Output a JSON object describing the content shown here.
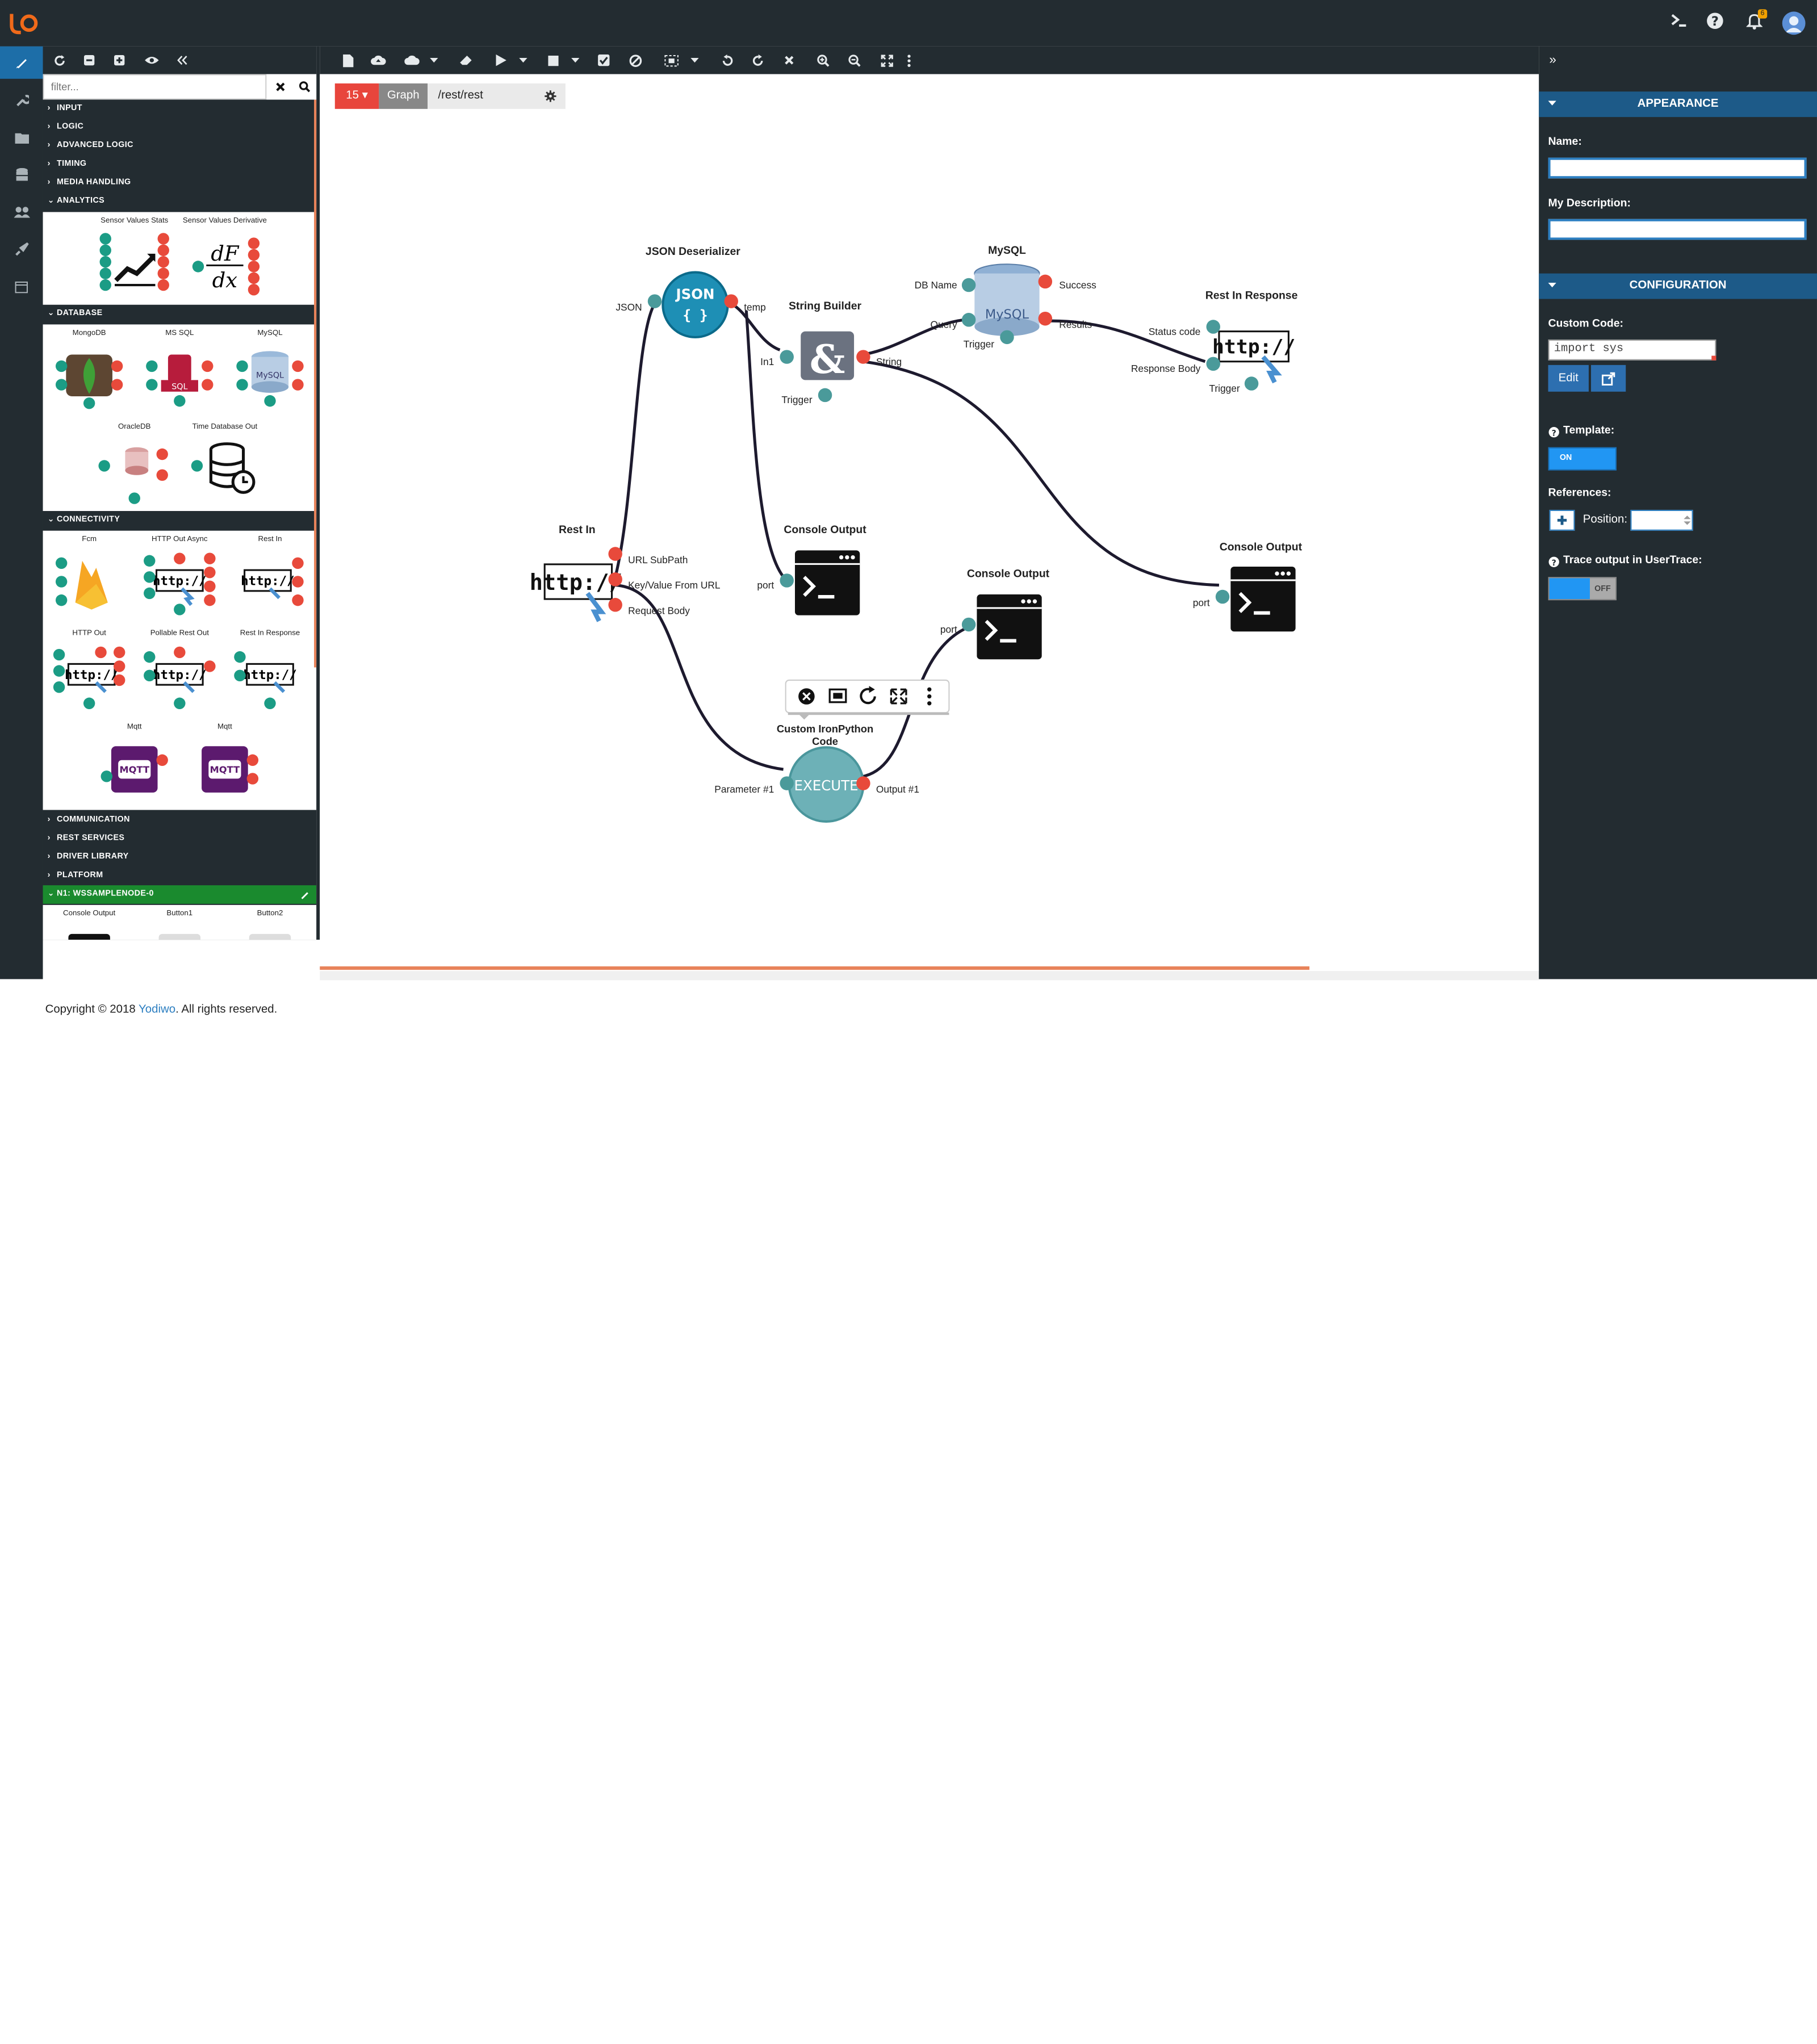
{
  "topbar": {
    "notifications_count": "6",
    "icons": [
      "logo",
      "terminal-icon",
      "help-icon",
      "bell-icon",
      "user-icon"
    ]
  },
  "left_toolbar": {
    "icons": [
      "refresh-icon",
      "collapse-all-icon",
      "expand-all-icon",
      "visibility-icon",
      "double-chevron-left-icon"
    ]
  },
  "main_toolbar": {
    "icons": [
      "new-file-icon",
      "upload-cloud-icon",
      "deploy-icon",
      "dropdown-icon",
      "eraser-icon",
      "play-icon",
      "dropdown-icon",
      "stop-icon",
      "dropdown-icon",
      "check-icon",
      "ban-icon",
      "select-icon",
      "dropdown-icon",
      "undo-icon",
      "redo-icon",
      "close-icon",
      "zoom-in-icon",
      "zoom-out-icon",
      "fit-icon",
      "more-icon"
    ]
  },
  "filter": {
    "placeholder": "filter..."
  },
  "categories": {
    "input": "INPUT",
    "logic": "LOGIC",
    "advanced_logic": "ADVANCED LOGIC",
    "timing": "TIMING",
    "media": "MEDIA HANDLING",
    "analytics": "ANALYTICS",
    "database": "DATABASE",
    "connectivity": "CONNECTIVITY",
    "communication": "COMMUNICATION",
    "rest": "REST SERVICES",
    "driver": "DRIVER LIBRARY",
    "platform": "PLATFORM",
    "node": "N1: WSSAMPLENODE-0"
  },
  "palette": {
    "analytics": [
      "Sensor Values Stats",
      "Sensor Values Derivative"
    ],
    "database": [
      "MongoDB",
      "MS SQL",
      "MySQL",
      "OracleDB",
      "Time Database Out"
    ],
    "connectivity": [
      "Fcm",
      "HTTP Out Async",
      "Rest In",
      "HTTP Out",
      "Pollable Rest Out",
      "Rest In Response",
      "Mqtt",
      "Mqtt"
    ],
    "node": [
      "Console Output",
      "Button1",
      "Button2"
    ]
  },
  "palette_icon_text": {
    "sql": "SQL",
    "mysql": "MySQL",
    "http": "http://",
    "mqtt": "MQTT",
    "json": "JSON",
    "json_braces": "{ }",
    "execute": "EXECUTE",
    "dfdx_num": "dF",
    "dfdx_den": "dx"
  },
  "graph_header": {
    "number": "15",
    "tab": "Graph",
    "path": "/rest/rest"
  },
  "nodes": {
    "json_deserializer": {
      "title": "JSON Deserializer",
      "in": "JSON",
      "out": "temp"
    },
    "string_builder": {
      "title": "String Builder",
      "in": "In1",
      "trigger": "Trigger",
      "out": "String"
    },
    "mysql": {
      "title": "MySQL",
      "in1": "DB Name",
      "in2": "Query",
      "trigger": "Trigger",
      "out1": "Success",
      "out2": "Results"
    },
    "rest_in_response": {
      "title": "Rest In Response",
      "in1": "Status code",
      "in2": "Response Body",
      "trigger": "Trigger"
    },
    "rest_in": {
      "title": "Rest In",
      "out1": "URL SubPath",
      "out2": "Key/Value From URL",
      "out3": "Request Body"
    },
    "console1": {
      "title": "Console Output",
      "port": "port"
    },
    "console2": {
      "title": "Console Output",
      "port": "port"
    },
    "console3": {
      "title": "Console Output",
      "port": "port"
    },
    "custom_python": {
      "title": "Custom IronPython Code",
      "in": "Parameter #1",
      "out": "Output #1"
    }
  },
  "properties": {
    "appearance": "APPEARANCE",
    "name_label": "Name:",
    "name_value": "",
    "desc_label": "My Description:",
    "desc_value": "",
    "configuration": "CONFIGURATION",
    "code_label": "Custom Code:",
    "code_value": "import sys",
    "edit_label": "Edit",
    "template_label": "Template:",
    "template_state": "ON",
    "references_label": "References:",
    "position_label": "Position:",
    "trace_label": "Trace output in UserTrace:",
    "trace_state": "OFF"
  },
  "footer": {
    "prefix": "Copyright © 2018 ",
    "brand": "Yodiwo",
    "suffix": ". All rights reserved."
  },
  "colors": {
    "bar": "#232c31",
    "accent": "#2d7fc1",
    "orange": "#e8835a",
    "red_port": "#e84a3b",
    "green_port": "#1b9c85",
    "teal_port": "#4a9a9a",
    "node_green_band": "#1a8a2e"
  }
}
